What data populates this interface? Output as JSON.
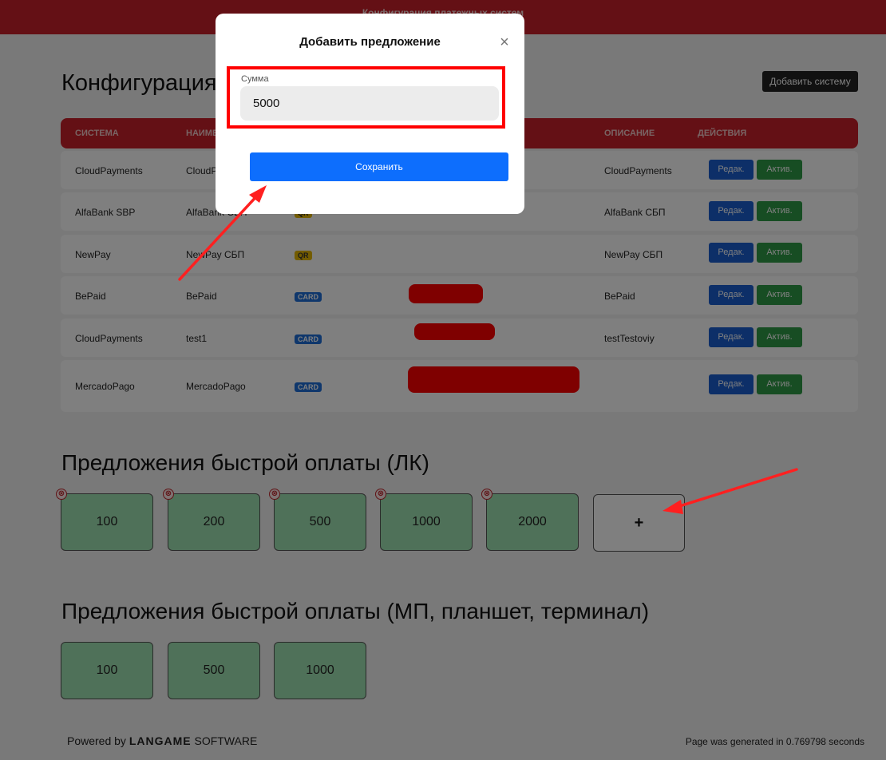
{
  "topbar": {
    "title": "Конфигурация платежных систем"
  },
  "page": {
    "title": "Конфигурация платежных систем",
    "add_system_label": "Добавить систему"
  },
  "table": {
    "headers": {
      "system": "СИСТЕМА",
      "name": "НАИМЕНОВАНИЕ",
      "description": "ОПИСАНИЕ",
      "actions": "ДЕЙСТВИЯ"
    },
    "rows": [
      {
        "system": "CloudPayments",
        "name": "CloudPayments",
        "type": "",
        "description": "CloudPayments"
      },
      {
        "system": "AlfaBank SBP",
        "name": "AlfaBank СБП",
        "type": "QR",
        "description": "AlfaBank СБП"
      },
      {
        "system": "NewPay",
        "name": "NewPay СБП",
        "type": "QR",
        "description": "NewPay СБП"
      },
      {
        "system": "BePaid",
        "name": "BePaid",
        "type": "CARD",
        "description": "BePaid"
      },
      {
        "system": "CloudPayments",
        "name": "test1",
        "type": "CARD",
        "description": "testTestoviy"
      },
      {
        "system": "MercadoPago",
        "name": "MercadoPago",
        "type": "CARD",
        "description": ""
      }
    ],
    "edit_label": "Редак.",
    "active_label": "Актив."
  },
  "section_lk": {
    "title": "Предложения быстрой оплаты (ЛК)",
    "amounts": [
      "100",
      "200",
      "500",
      "1000",
      "2000"
    ],
    "add_label": "+",
    "remove_icon": "⊗"
  },
  "section_mp": {
    "title": "Предложения быстрой оплаты (МП, планшет, терминал)",
    "amounts": [
      "100",
      "500",
      "1000"
    ]
  },
  "footer": {
    "powered_prefix": "Powered by",
    "brand": "LANGAME",
    "brand_suffix": "SOFTWARE",
    "generated": "Page was generated in 0.769798 seconds"
  },
  "modal": {
    "title": "Добавить предложение",
    "field_label": "Сумма",
    "field_value": "5000",
    "save_label": "Сохранить",
    "close_icon": "×"
  },
  "colors": {
    "brand_red": "#c8202a",
    "primary_blue": "#0d6efd",
    "success_green": "#2e9a46",
    "tile_green": "#9fe3b2",
    "annotation_red": "#ff0000"
  }
}
